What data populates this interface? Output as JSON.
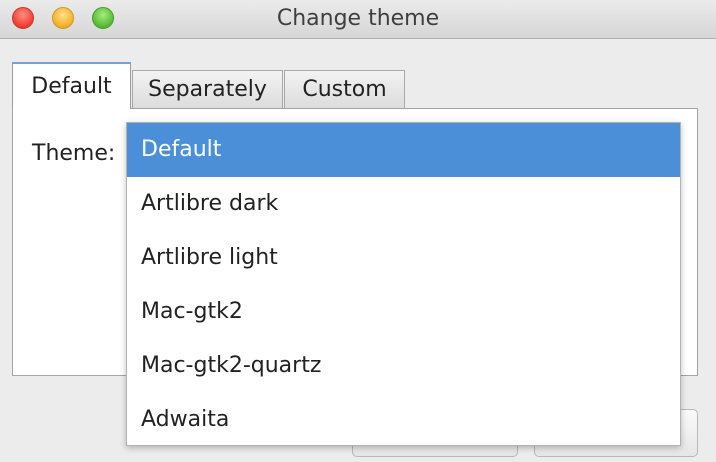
{
  "window": {
    "title": "Change theme",
    "controls": {
      "close_icon": "close-traffic-light",
      "minimize_icon": "minimize-traffic-light",
      "zoom_icon": "zoom-traffic-light",
      "close_color": "#f2473a",
      "minimize_color": "#f6b532",
      "zoom_color": "#5dc23b"
    }
  },
  "tabs": [
    {
      "label": "Default",
      "active": true
    },
    {
      "label": "Separately",
      "active": false
    },
    {
      "label": "Custom",
      "active": false
    }
  ],
  "theme_field": {
    "label": "Theme:"
  },
  "dropdown": {
    "selected_color": "#4a8fd7",
    "options": [
      {
        "label": "Default",
        "selected": true
      },
      {
        "label": "Artlibre dark",
        "selected": false
      },
      {
        "label": "Artlibre light",
        "selected": false
      },
      {
        "label": "Mac-gtk2",
        "selected": false
      },
      {
        "label": "Mac-gtk2-quartz",
        "selected": false
      },
      {
        "label": "Adwaita",
        "selected": false
      }
    ]
  }
}
